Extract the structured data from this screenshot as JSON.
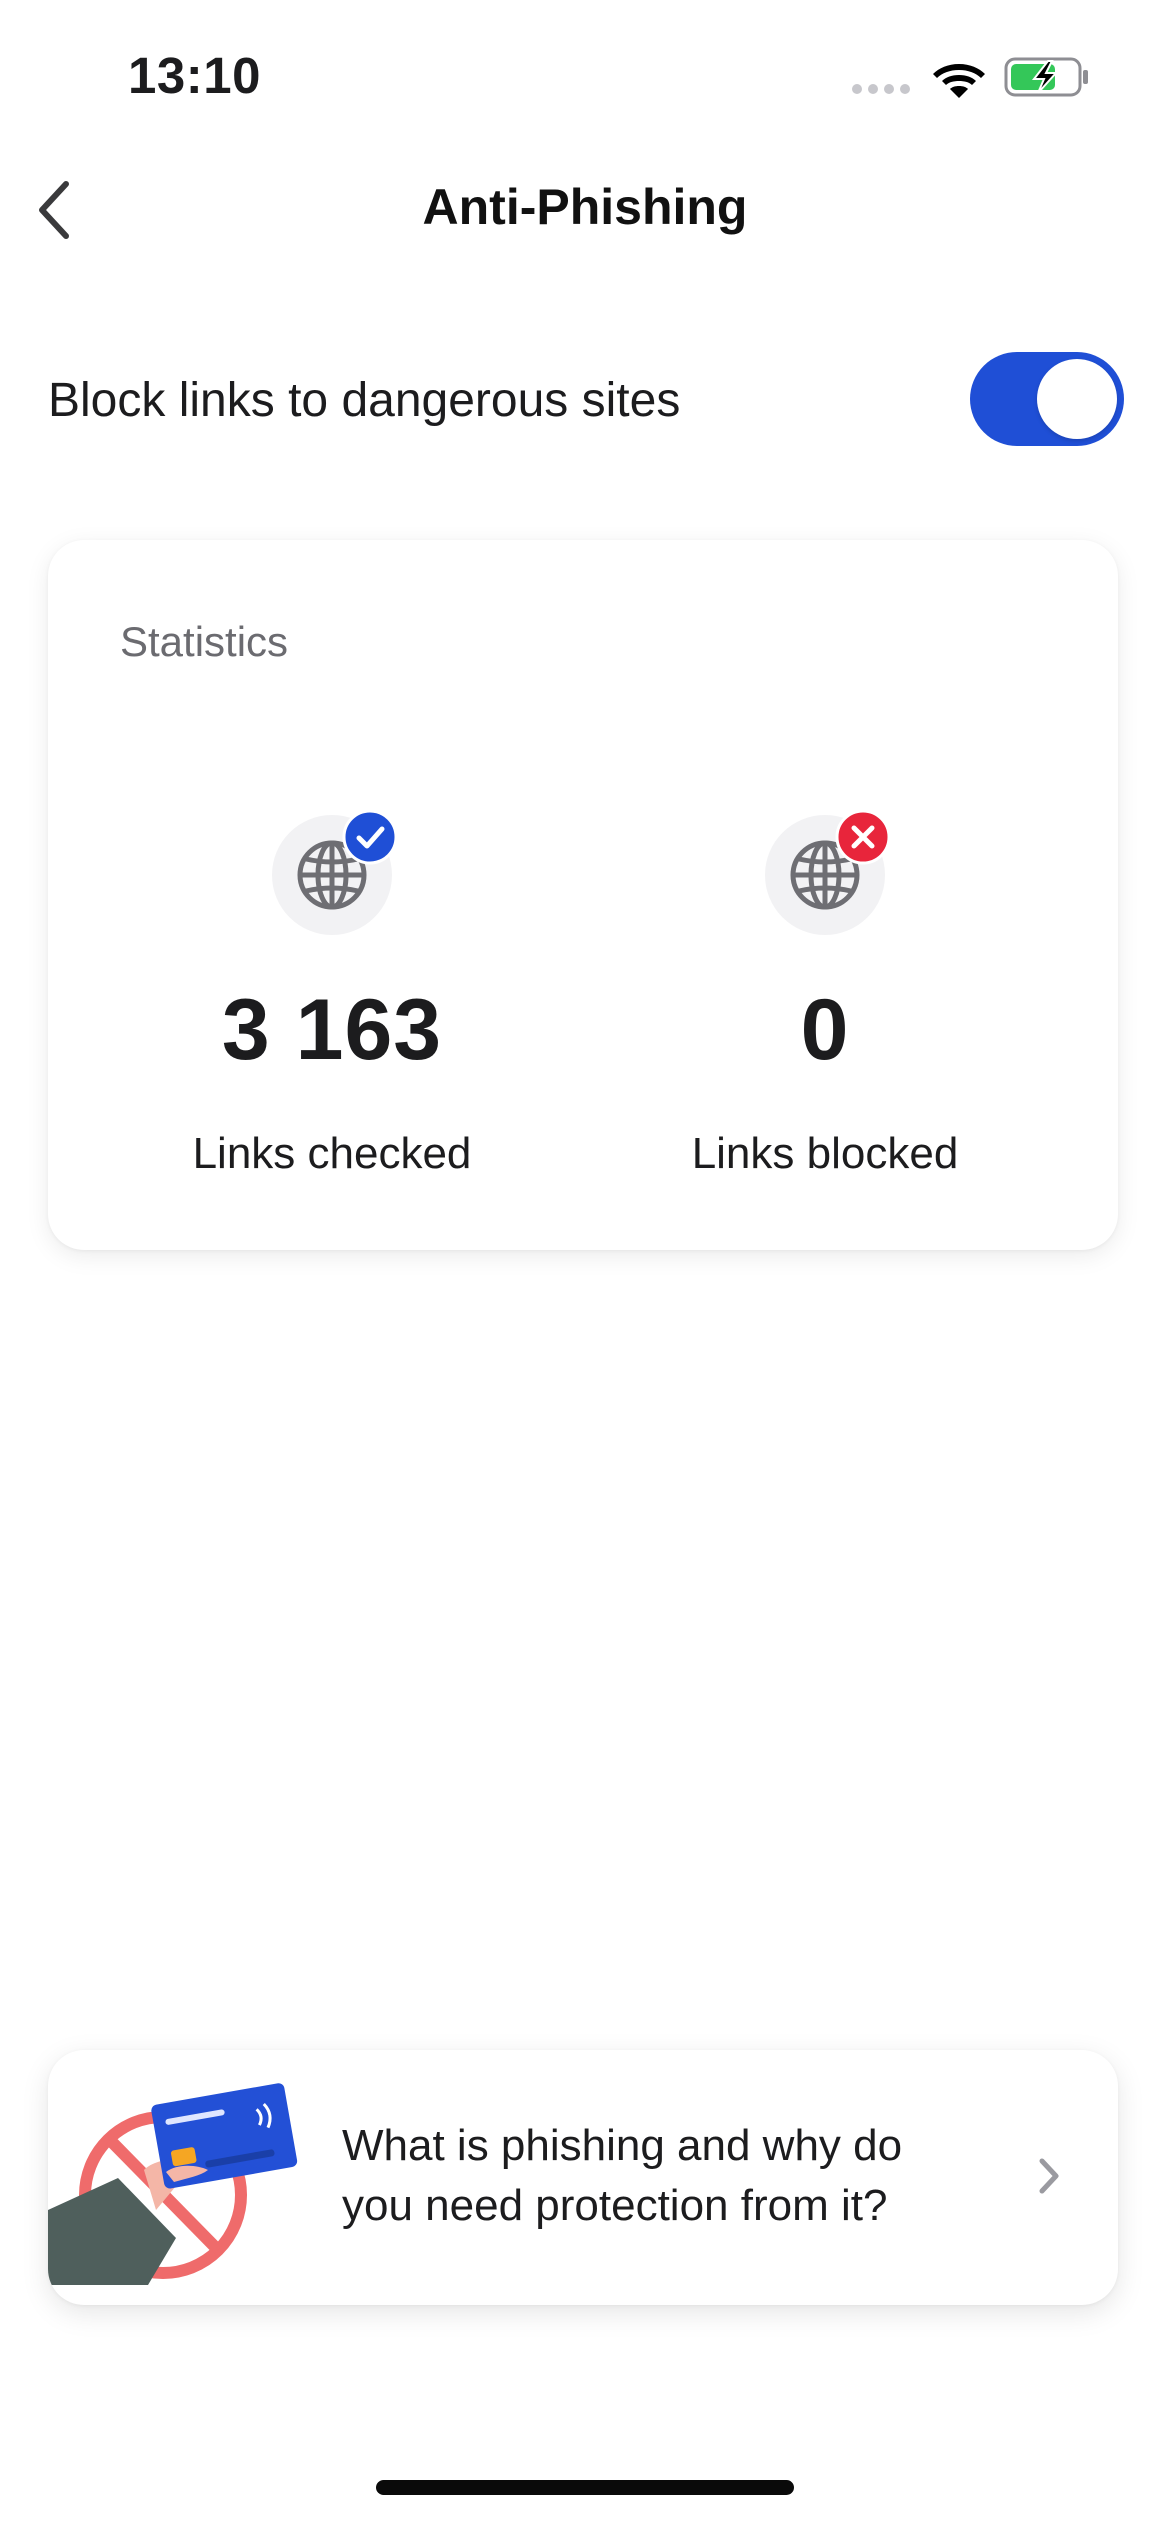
{
  "status_bar": {
    "time": "13:10",
    "wifi_icon": "wifi-icon",
    "battery_icon": "battery-charging-icon",
    "battery_color": "#34c759"
  },
  "nav": {
    "title": "Anti-Phishing",
    "back_icon": "chevron-left-icon"
  },
  "setting": {
    "label": "Block links to dangerous sites",
    "enabled": true,
    "toggle_color": "#1f4fd6"
  },
  "stats": {
    "heading": "Statistics",
    "items": [
      {
        "value": "3 163",
        "label": "Links checked",
        "icon": "globe-icon",
        "badge": "check-badge-icon",
        "badge_color": "#1f4fd6"
      },
      {
        "value": "0",
        "label": "Links blocked",
        "icon": "globe-icon",
        "badge": "x-badge-icon",
        "badge_color": "#e8253b"
      }
    ]
  },
  "info": {
    "text": "What is phishing and why do you need protection from it?",
    "chevron_icon": "chevron-right-icon",
    "illustration": "phishing-card-illustration"
  }
}
